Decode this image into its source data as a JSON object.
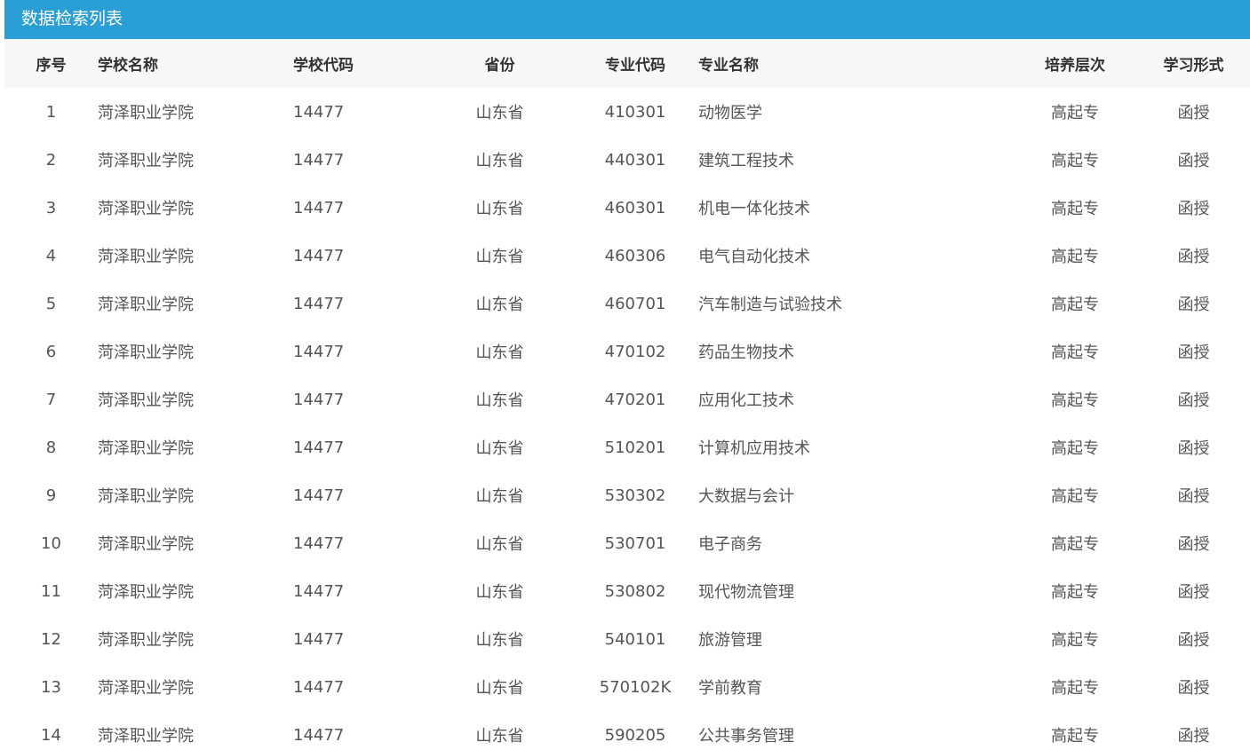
{
  "header": {
    "title": "数据检索列表"
  },
  "columns": [
    "序号",
    "学校名称",
    "学校代码",
    "省份",
    "专业代码",
    "专业名称",
    "培养层次",
    "学习形式"
  ],
  "rows": [
    [
      "1",
      "菏泽职业学院",
      "14477",
      "山东省",
      "410301",
      "动物医学",
      "高起专",
      "函授"
    ],
    [
      "2",
      "菏泽职业学院",
      "14477",
      "山东省",
      "440301",
      "建筑工程技术",
      "高起专",
      "函授"
    ],
    [
      "3",
      "菏泽职业学院",
      "14477",
      "山东省",
      "460301",
      "机电一体化技术",
      "高起专",
      "函授"
    ],
    [
      "4",
      "菏泽职业学院",
      "14477",
      "山东省",
      "460306",
      "电气自动化技术",
      "高起专",
      "函授"
    ],
    [
      "5",
      "菏泽职业学院",
      "14477",
      "山东省",
      "460701",
      "汽车制造与试验技术",
      "高起专",
      "函授"
    ],
    [
      "6",
      "菏泽职业学院",
      "14477",
      "山东省",
      "470102",
      "药品生物技术",
      "高起专",
      "函授"
    ],
    [
      "7",
      "菏泽职业学院",
      "14477",
      "山东省",
      "470201",
      "应用化工技术",
      "高起专",
      "函授"
    ],
    [
      "8",
      "菏泽职业学院",
      "14477",
      "山东省",
      "510201",
      "计算机应用技术",
      "高起专",
      "函授"
    ],
    [
      "9",
      "菏泽职业学院",
      "14477",
      "山东省",
      "530302",
      "大数据与会计",
      "高起专",
      "函授"
    ],
    [
      "10",
      "菏泽职业学院",
      "14477",
      "山东省",
      "530701",
      "电子商务",
      "高起专",
      "函授"
    ],
    [
      "11",
      "菏泽职业学院",
      "14477",
      "山东省",
      "530802",
      "现代物流管理",
      "高起专",
      "函授"
    ],
    [
      "12",
      "菏泽职业学院",
      "14477",
      "山东省",
      "540101",
      "旅游管理",
      "高起专",
      "函授"
    ],
    [
      "13",
      "菏泽职业学院",
      "14477",
      "山东省",
      "570102K",
      "学前教育",
      "高起专",
      "函授"
    ],
    [
      "14",
      "菏泽职业学院",
      "14477",
      "山东省",
      "590205",
      "公共事务管理",
      "高起专",
      "函授"
    ]
  ],
  "colors": {
    "header_background": "#2a9fd6",
    "table_head_background": "#f7f7f7",
    "cell_text": "#555555"
  }
}
